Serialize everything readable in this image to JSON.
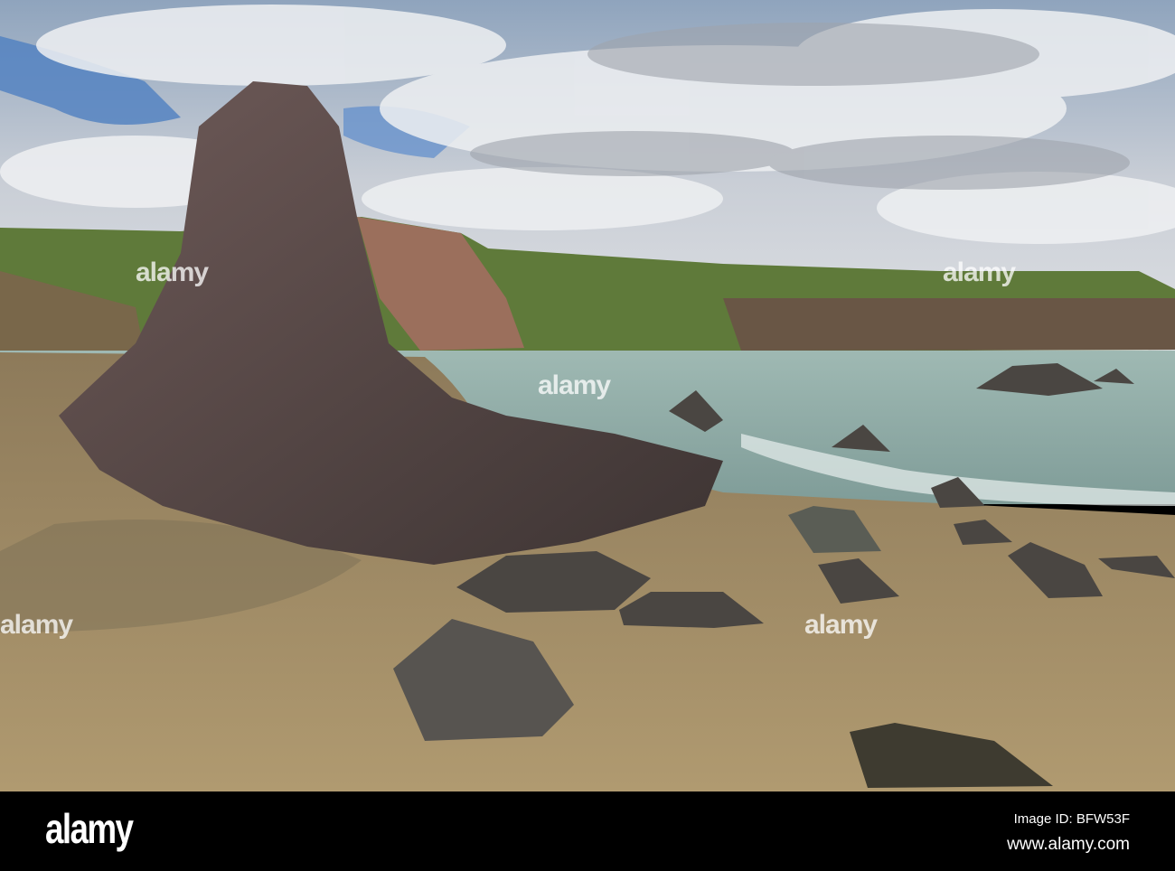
{
  "watermark": {
    "text": "alamy"
  },
  "footer": {
    "logo": "alamy",
    "image_id": "Image ID: BFW53F",
    "url": "www.alamy.com"
  }
}
